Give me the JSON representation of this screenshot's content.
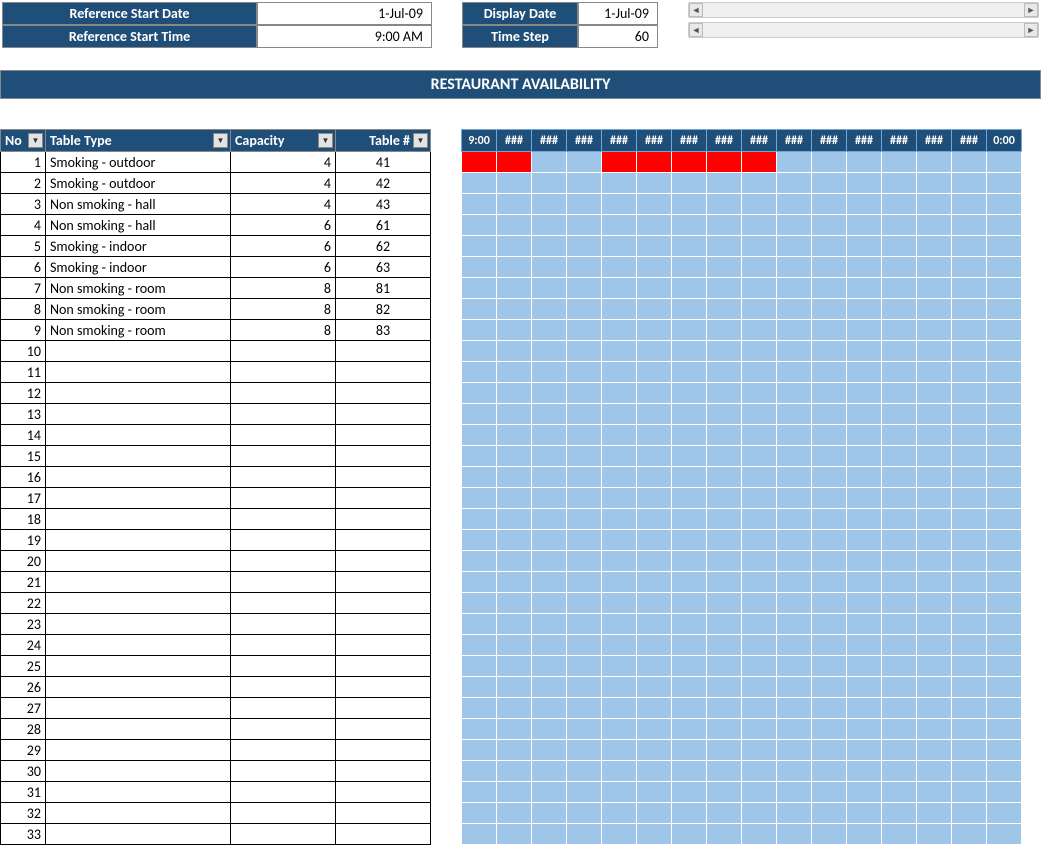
{
  "ref": {
    "start_date_label": "Reference Start Date",
    "start_date_value": "1-Jul-09",
    "start_time_label": "Reference Start Time",
    "start_time_value": "9:00 AM"
  },
  "display": {
    "date_label": "Display Date",
    "date_value": "1-Jul-09",
    "step_label": "Time Step",
    "step_value": "60"
  },
  "title": "RESTAURANT AVAILABILITY",
  "columns": {
    "no": "No",
    "type": "Table Type",
    "cap": "Capacity",
    "tbl": "Table #"
  },
  "rows": [
    {
      "no": "1",
      "type": "Smoking - outdoor",
      "cap": "4",
      "tbl": "41"
    },
    {
      "no": "2",
      "type": "Smoking - outdoor",
      "cap": "4",
      "tbl": "42"
    },
    {
      "no": "3",
      "type": "Non smoking - hall",
      "cap": "4",
      "tbl": "43"
    },
    {
      "no": "4",
      "type": "Non smoking - hall",
      "cap": "6",
      "tbl": "61"
    },
    {
      "no": "5",
      "type": "Smoking - indoor",
      "cap": "6",
      "tbl": "62"
    },
    {
      "no": "6",
      "type": "Smoking - indoor",
      "cap": "6",
      "tbl": "63"
    },
    {
      "no": "7",
      "type": "Non smoking - room",
      "cap": "8",
      "tbl": "81"
    },
    {
      "no": "8",
      "type": "Non smoking - room",
      "cap": "8",
      "tbl": "82"
    },
    {
      "no": "9",
      "type": "Non smoking - room",
      "cap": "8",
      "tbl": "83"
    },
    {
      "no": "10",
      "type": "",
      "cap": "",
      "tbl": ""
    },
    {
      "no": "11",
      "type": "",
      "cap": "",
      "tbl": ""
    },
    {
      "no": "12",
      "type": "",
      "cap": "",
      "tbl": ""
    },
    {
      "no": "13",
      "type": "",
      "cap": "",
      "tbl": ""
    },
    {
      "no": "14",
      "type": "",
      "cap": "",
      "tbl": ""
    },
    {
      "no": "15",
      "type": "",
      "cap": "",
      "tbl": ""
    },
    {
      "no": "16",
      "type": "",
      "cap": "",
      "tbl": ""
    },
    {
      "no": "17",
      "type": "",
      "cap": "",
      "tbl": ""
    },
    {
      "no": "18",
      "type": "",
      "cap": "",
      "tbl": ""
    },
    {
      "no": "19",
      "type": "",
      "cap": "",
      "tbl": ""
    },
    {
      "no": "20",
      "type": "",
      "cap": "",
      "tbl": ""
    },
    {
      "no": "21",
      "type": "",
      "cap": "",
      "tbl": ""
    },
    {
      "no": "22",
      "type": "",
      "cap": "",
      "tbl": ""
    },
    {
      "no": "23",
      "type": "",
      "cap": "",
      "tbl": ""
    },
    {
      "no": "24",
      "type": "",
      "cap": "",
      "tbl": ""
    },
    {
      "no": "25",
      "type": "",
      "cap": "",
      "tbl": ""
    },
    {
      "no": "26",
      "type": "",
      "cap": "",
      "tbl": ""
    },
    {
      "no": "27",
      "type": "",
      "cap": "",
      "tbl": ""
    },
    {
      "no": "28",
      "type": "",
      "cap": "",
      "tbl": ""
    },
    {
      "no": "29",
      "type": "",
      "cap": "",
      "tbl": ""
    },
    {
      "no": "30",
      "type": "",
      "cap": "",
      "tbl": ""
    },
    {
      "no": "31",
      "type": "",
      "cap": "",
      "tbl": ""
    },
    {
      "no": "32",
      "type": "",
      "cap": "",
      "tbl": ""
    },
    {
      "no": "33",
      "type": "",
      "cap": "",
      "tbl": ""
    }
  ],
  "time_headers": [
    "9:00",
    "###",
    "###",
    "###",
    "###",
    "###",
    "###",
    "###",
    "###",
    "###",
    "###",
    "###",
    "###",
    "###",
    "###",
    "0:00"
  ],
  "bookings": [
    {
      "row": 0,
      "cols": [
        0,
        1,
        4,
        5,
        6,
        7,
        8
      ]
    }
  ],
  "grid_rows": 33,
  "grid_cols": 16
}
